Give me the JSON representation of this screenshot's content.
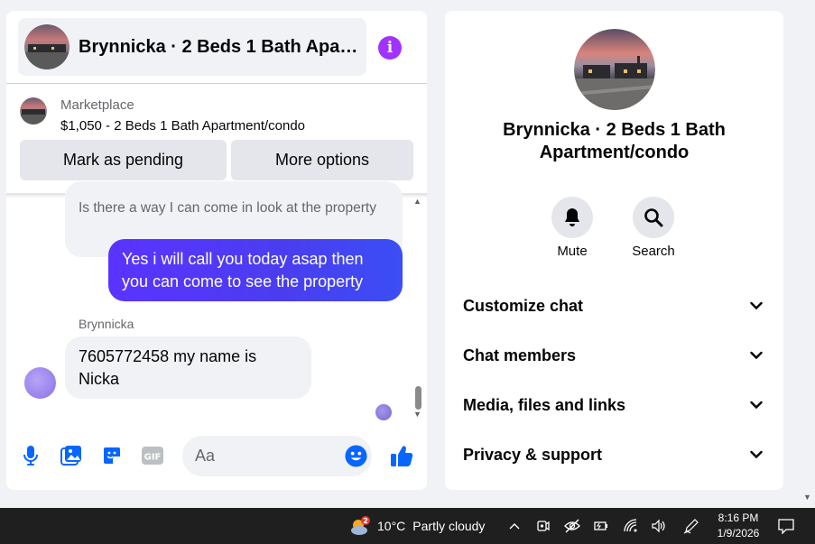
{
  "chat": {
    "header_title": "Brynnicka · 2 Beds 1 Bath Apartment/condo",
    "listing_source": "Marketplace",
    "listing_price_title": "$1,050 - 2 Beds 1 Bath Apartment/condo",
    "mark_pending_label": "Mark as pending",
    "more_options_label": "More options"
  },
  "messages": [
    {
      "direction": "in",
      "text": "Is there a way I can come in look at the property"
    },
    {
      "direction": "out",
      "text": "Yes i will call you today asap then you can come to see the property"
    },
    {
      "direction": "in",
      "sender": "Brynnicka",
      "text": "7605772458 my name is Nicka"
    }
  ],
  "composer": {
    "placeholder": "Aa"
  },
  "info": {
    "title": "Brynnicka · 2 Beds 1 Bath Apartment/condo",
    "mute_label": "Mute",
    "search_label": "Search",
    "sections": [
      "Customize chat",
      "Chat members",
      "Media, files and links",
      "Privacy & support"
    ]
  },
  "taskbar": {
    "weather_badge": "2",
    "temperature": "10°C",
    "condition": "Partly cloudy",
    "time": "8:16 PM",
    "date": "1/9/2026"
  },
  "colors": {
    "accent": "#0866ff",
    "outgoing_bubble": "#4a3df0",
    "info_icon": "#a033ff"
  },
  "icons": [
    "info-icon",
    "microphone-icon",
    "photo-icon",
    "sticker-icon",
    "gif-icon",
    "emoji-icon",
    "thumbs-up-icon",
    "bell-icon",
    "search-icon",
    "chevron-down-icon",
    "weather-icon",
    "chevron-up-icon",
    "camera-icon",
    "network-off-icon",
    "battery-icon",
    "wifi-icon",
    "volume-icon",
    "pen-icon",
    "notification-icon"
  ]
}
